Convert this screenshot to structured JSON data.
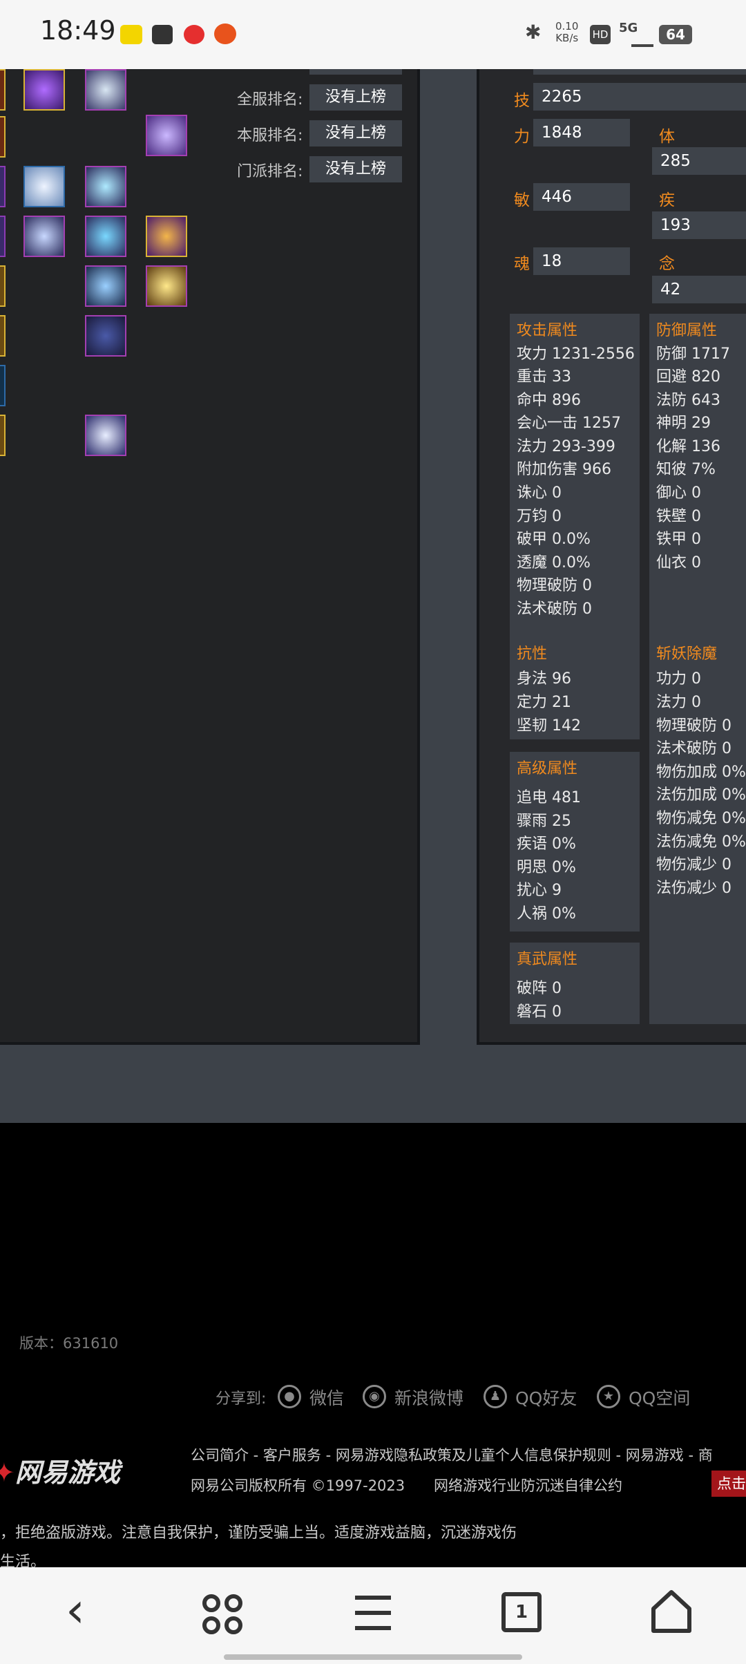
{
  "status_bar": {
    "time": "18:49",
    "net_speed_top": "0.10",
    "net_speed_bottom": "KB/s",
    "hd": "HD",
    "signal": "5G",
    "battery": "64"
  },
  "rankings": [
    {
      "label": "全服排名:",
      "value": "没有上榜"
    },
    {
      "label": "本服排名:",
      "value": "没有上榜"
    },
    {
      "label": "门派排名:",
      "value": "没有上榜"
    }
  ],
  "attributes": {
    "skill": {
      "label": "技",
      "value": "2265"
    },
    "strength": {
      "label": "力",
      "value": "1848"
    },
    "body": {
      "label": "体",
      "value": "285"
    },
    "agility": {
      "label": "敏",
      "value": "446"
    },
    "speed": {
      "label": "疾",
      "value": "193"
    },
    "soul": {
      "label": "魂",
      "value": "18"
    },
    "mind": {
      "label": "念",
      "value": "42"
    }
  },
  "attack": {
    "title": "攻击属性",
    "rows": [
      "攻力 1231-2556",
      "重击 33",
      "命中 896",
      "会心一击 1257",
      "法力 293-399",
      "附加伤害 966",
      "诛心 0",
      "万钧 0",
      "破甲 0.0%",
      "透魔 0.0%",
      "物理破防 0",
      "法术破防 0"
    ]
  },
  "defense": {
    "title": "防御属性",
    "rows": [
      "防御 1717",
      "回避 820",
      "法防 643",
      "神明 29",
      "化解 136",
      "知彼 7%",
      "御心 0",
      "铁壁 0",
      "铁甲 0",
      "仙衣 0"
    ]
  },
  "resist": {
    "title": "抗性",
    "rows": [
      "身法 96",
      "定力 21",
      "坚韧 142"
    ]
  },
  "advanced": {
    "title": "高级属性",
    "rows": [
      "追电 481",
      "骤雨 25",
      "疾语 0%",
      "明思 0%",
      "扰心 9",
      "人祸 0%"
    ]
  },
  "zhenwu": {
    "title": "真武属性",
    "rows": [
      "破阵 0",
      "磐石 0"
    ]
  },
  "demon": {
    "title": "斩妖除魔",
    "rows": [
      "功力 0",
      "法力 0",
      "物理破防 0",
      "法术破防 0",
      "物伤加成 0%",
      "法伤加成 0%",
      "物伤减免 0%",
      "法伤减免 0%",
      "物伤减少 0",
      "法伤减少 0"
    ]
  },
  "footer": {
    "version": "版本：631610",
    "share_label": "分享到:",
    "share": [
      "微信",
      "新浪微博",
      "QQ好友",
      "QQ空间"
    ],
    "links": "公司简介 - 客户服务 - 网易游戏隐私政策及儿童个人信息保护规则 - 网易游戏 - 商",
    "copyright": "网易公司版权所有 ©1997-2023",
    "anti_addiction": "网络游戏行业防沉迷自律公约",
    "click": "点击",
    "logo": "网易游戏",
    "notice_line1": "，拒绝盗版游戏。注意自我保护，谨防受骗上当。适度游戏益脑，沉迷游戏伤",
    "notice_line2": "生活。"
  },
  "bottom_nav": {
    "tab_count": "1"
  },
  "colors": {
    "accent": "#f08a1e",
    "panel": "#3b3f46",
    "background": "#222325"
  }
}
